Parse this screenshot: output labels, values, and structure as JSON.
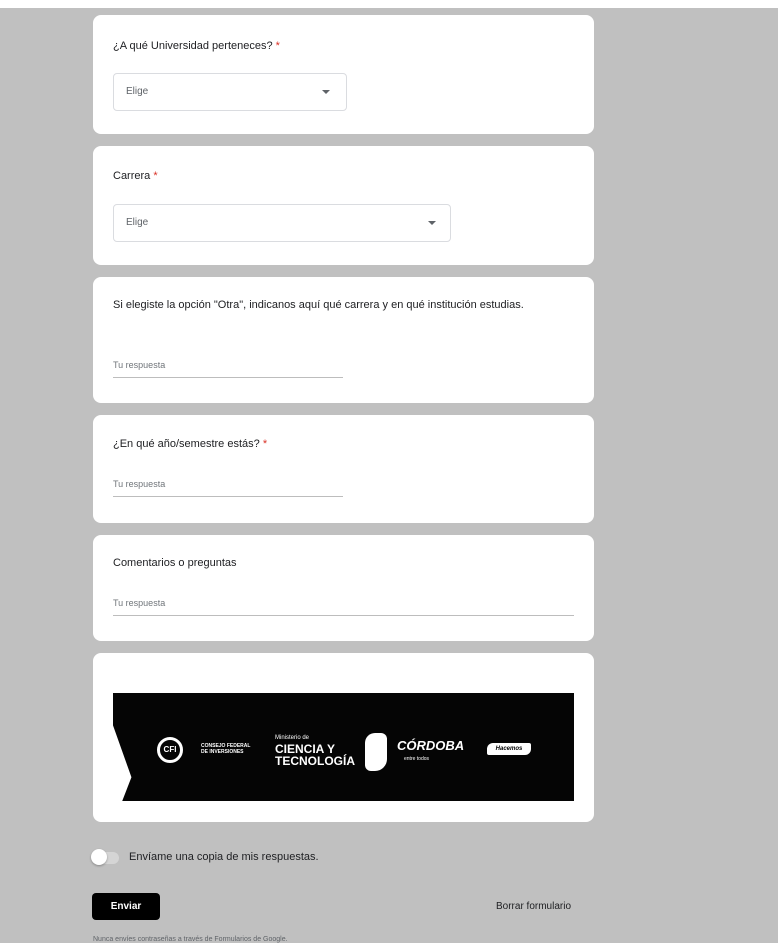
{
  "questions": [
    {
      "label": "¿A qué Universidad perteneces?",
      "required_mark": "*",
      "select_value": "Elige"
    },
    {
      "label": "Carrera",
      "required_mark": "*",
      "select_value": "Elige"
    },
    {
      "label": "Si elegiste la opción \"Otra\", indicanos aquí qué carrera y en qué institución estudias.",
      "placeholder": "Tu respuesta"
    },
    {
      "label": "¿En qué año/semestre estás?",
      "required_mark": "*",
      "placeholder": "Tu respuesta"
    },
    {
      "label": "Comentarios o preguntas",
      "placeholder": "Tu respuesta"
    }
  ],
  "banner": {
    "cfi_logo": "CFI",
    "cfi_text_line1": "CONSEJO FEDERAL",
    "cfi_text_line2": "DE INVERSIONES",
    "ministerio_small": "Ministerio de",
    "ministerio_line1": "CIENCIA Y",
    "ministerio_line2": "TECNOLOGÍA",
    "cordoba": "CÓRDOBA",
    "entre_todos": "entre todos",
    "hacemos": "Hacemos"
  },
  "copy_toggle_label": "Envíame una copia de mis respuestas.",
  "submit_label": "Enviar",
  "clear_label": "Borrar formulario",
  "footer_text": "Nunca envíes contraseñas a través de Formularios de Google."
}
